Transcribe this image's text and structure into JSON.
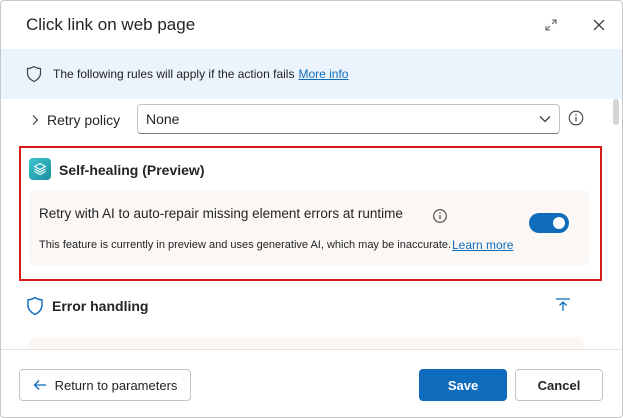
{
  "dialog": {
    "title": "Click link on web page"
  },
  "infobar": {
    "message": "The following rules will apply if the action fails",
    "link": "More info"
  },
  "retry_policy": {
    "label": "Retry policy",
    "value": "None"
  },
  "self_healing": {
    "title": "Self-healing (Preview)",
    "option_label": "Retry with AI to auto-repair missing element errors at runtime",
    "note": "This feature is currently in preview and uses generative AI, which may be inaccurate.",
    "learn_more": "Learn more",
    "toggle_on": true
  },
  "error_handling": {
    "title": "Error handling"
  },
  "footer": {
    "back_label": "Return to parameters",
    "save_label": "Save",
    "cancel_label": "Cancel"
  },
  "colors": {
    "accent": "#0f6cbd",
    "highlight_border": "#d71a1a",
    "info_bar_bg": "#ebf3fc"
  },
  "icons": {
    "expand": "expand-icon",
    "close": "close-icon",
    "info_shield": "shield-icon",
    "retry_chevron": "chevron-right-icon",
    "dropdown": "chevron-down-icon",
    "info": "info-icon",
    "self_healing": "layers-icon",
    "error_shield": "shield-icon",
    "collapse": "collapse-up-icon",
    "back_arrow": "arrow-left-icon"
  }
}
